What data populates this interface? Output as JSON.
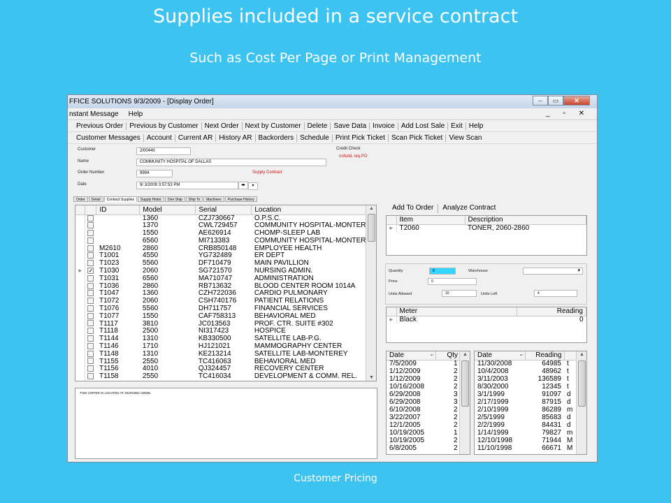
{
  "slide": {
    "title": "Supplies included in a service contract",
    "subtitle": "Such as Cost Per Page or Print Management",
    "footer": "Customer Pricing"
  },
  "window": {
    "title": "FFICE SOLUTIONS 9/3/2009 - [Display Order]",
    "menu": [
      "nstant Message",
      "Help"
    ],
    "mdi_controls": "_ ▫ ✕"
  },
  "toolbar1": [
    "Previous Order",
    "Previous by Customer",
    "Next Order",
    "Next by Customer",
    "Delete",
    "Save Data",
    "Invoice",
    "Add Lost Sale",
    "Exit",
    "Help"
  ],
  "toolbar2": [
    "Customer Messages",
    "Account",
    "Current AR",
    "History AR",
    "Backorders",
    "Schedule",
    "Print Pick Ticket",
    "Scan Pick Ticket",
    "View Scan"
  ],
  "header": {
    "customer_label": "Customer",
    "customer_value": "2/00440",
    "name_label": "Name",
    "name_value": "COMMUNITY HOSPITAL OF DALLAS",
    "order_label": "Order Number",
    "order_value": "9994",
    "date_label": "Date",
    "date_value": "9/ 3/2009   3:57:53 PM",
    "credit_label": "Credit Check",
    "credit_value": "nohold, req PO",
    "contract_flag": "Supply Contract"
  },
  "tabs": [
    "Order",
    "Detail",
    "Contract Supplies",
    "Supply Histor",
    "One Ship",
    "Ship To",
    "Machines",
    "Purchase History"
  ],
  "machines": {
    "columns": [
      "ID",
      "Model",
      "Serial",
      "Location"
    ],
    "rows": [
      {
        "id": "",
        "model": "1360",
        "serial": "CZJ730667",
        "location": "O.P.S.C.",
        "checked": false
      },
      {
        "id": "",
        "model": "1370",
        "serial": "CWL729457",
        "location": "COMMUNITY HOSPITAL-MONTER",
        "checked": false
      },
      {
        "id": "",
        "model": "1550",
        "serial": "AE626914",
        "location": "CHOMP-SLEEP LAB",
        "checked": false
      },
      {
        "id": "",
        "model": "6560",
        "serial": "MI713383",
        "location": "COMMUNITY HOSPITAL-MONTER",
        "checked": false
      },
      {
        "id": "M2610",
        "model": "2860",
        "serial": "CRB850148",
        "location": "EMPLOYEE HEALTH",
        "checked": false
      },
      {
        "id": "T1001",
        "model": "4550",
        "serial": "YG732489",
        "location": "ER DEPT",
        "checked": false
      },
      {
        "id": "T1023",
        "model": "5560",
        "serial": "DF710479",
        "location": "MAIN PAVILLION",
        "checked": false
      },
      {
        "id": "T1030",
        "model": "2060",
        "serial": "SG721570",
        "location": "NURSING ADMIN.",
        "checked": true
      },
      {
        "id": "T1031",
        "model": "6560",
        "serial": "MA710747",
        "location": "ADMINISTRATION",
        "checked": false
      },
      {
        "id": "T1036",
        "model": "2860",
        "serial": "RB713632",
        "location": "BLOOD CENTER  ROOM 1014A",
        "checked": false
      },
      {
        "id": "T1047",
        "model": "1360",
        "serial": "CZH722036",
        "location": "CARDIO PULMONARY",
        "checked": false
      },
      {
        "id": "T1072",
        "model": "2060",
        "serial": "CSH740176",
        "location": "PATIENT RELATIONS",
        "checked": false
      },
      {
        "id": "T1076",
        "model": "5560",
        "serial": "DH711757",
        "location": "FINANCIAL SERVICES",
        "checked": false
      },
      {
        "id": "T1077",
        "model": "1550",
        "serial": "CAF758313",
        "location": "BEHAVIORAL MED",
        "checked": false
      },
      {
        "id": "T1117",
        "model": "3810",
        "serial": "JC013563",
        "location": "PROF. CTR. SUITE #302",
        "checked": false
      },
      {
        "id": "T1118",
        "model": "2500",
        "serial": "NI317423",
        "location": "HOSPICE",
        "checked": false
      },
      {
        "id": "T1144",
        "model": "1310",
        "serial": "KB330500",
        "location": "SATELLITE LAB-P.G.",
        "checked": false
      },
      {
        "id": "T1146",
        "model": "1710",
        "serial": "HJ121021",
        "location": "MAMMOGRAPHY CENTER",
        "checked": false
      },
      {
        "id": "T1148",
        "model": "1310",
        "serial": "KE213214",
        "location": "SATELLITE LAB-MONTEREY",
        "checked": false
      },
      {
        "id": "T1155",
        "model": "2550",
        "serial": "TC416063",
        "location": "BEHAVIORAL MED",
        "checked": false
      },
      {
        "id": "T1156",
        "model": "4010",
        "serial": "QJ324457",
        "location": "RECOVERY CENTER",
        "checked": false
      },
      {
        "id": "T1158",
        "model": "2550",
        "serial": "TC416034",
        "location": "DEVELOPMENT & COMM. REL.",
        "checked": false
      }
    ]
  },
  "notes": "THIS COPIER IS LOCATED AT:  NURSING ADMIN.",
  "right_toolbar": [
    "Add To Order",
    "Analyze Contract"
  ],
  "items": {
    "columns": [
      "Item",
      "Description"
    ],
    "rows": [
      {
        "item": "T2060",
        "description": "TONER, 2060-2860"
      }
    ]
  },
  "qty": {
    "quantity_label": "Quantity",
    "quantity_value": "8",
    "warehouse_label": "Warehouse",
    "price_label": "Price",
    "price_value": "0",
    "units_allowed_label": "Units Allowed",
    "units_allowed_value": "10",
    "units_left_label": "Units Left",
    "units_left_value": "4"
  },
  "meter": {
    "columns": [
      "Meter",
      "Reading"
    ],
    "rows": [
      {
        "meter": "Black",
        "reading": "0"
      }
    ]
  },
  "history": {
    "columns": [
      "Date",
      "Qty"
    ],
    "rows": [
      {
        "date": "7/5/2009",
        "qty": "1"
      },
      {
        "date": "1/12/2009",
        "qty": "2"
      },
      {
        "date": "1/12/2009",
        "qty": "2"
      },
      {
        "date": "10/16/2008",
        "qty": "2"
      },
      {
        "date": "6/29/2008",
        "qty": "3"
      },
      {
        "date": "6/29/2008",
        "qty": "3"
      },
      {
        "date": "6/10/2008",
        "qty": "2"
      },
      {
        "date": "3/22/2007",
        "qty": "2"
      },
      {
        "date": "12/1/2005",
        "qty": "2"
      },
      {
        "date": "10/19/2005",
        "qty": "1"
      },
      {
        "date": "10/19/2005",
        "qty": "2"
      },
      {
        "date": "6/8/2005",
        "qty": "2"
      }
    ]
  },
  "readings": {
    "columns": [
      "Date",
      "Reading"
    ],
    "rows": [
      {
        "date": "11/30/2008",
        "reading": "64985",
        "flag": "t"
      },
      {
        "date": "10/4/2008",
        "reading": "48962",
        "flag": "t"
      },
      {
        "date": "3/11/2003",
        "reading": "136589",
        "flag": "t"
      },
      {
        "date": "8/30/2000",
        "reading": "12345",
        "flag": "t"
      },
      {
        "date": "3/1/1999",
        "reading": "91097",
        "flag": "d"
      },
      {
        "date": "2/17/1999",
        "reading": "87915",
        "flag": "d"
      },
      {
        "date": "2/10/1999",
        "reading": "86289",
        "flag": "m"
      },
      {
        "date": "2/5/1999",
        "reading": "85683",
        "flag": "d"
      },
      {
        "date": "2/2/1999",
        "reading": "84431",
        "flag": "d"
      },
      {
        "date": "1/14/1999",
        "reading": "79827",
        "flag": "m"
      },
      {
        "date": "12/10/1998",
        "reading": "71944",
        "flag": "M"
      },
      {
        "date": "11/10/1998",
        "reading": "66671",
        "flag": "M"
      }
    ]
  }
}
